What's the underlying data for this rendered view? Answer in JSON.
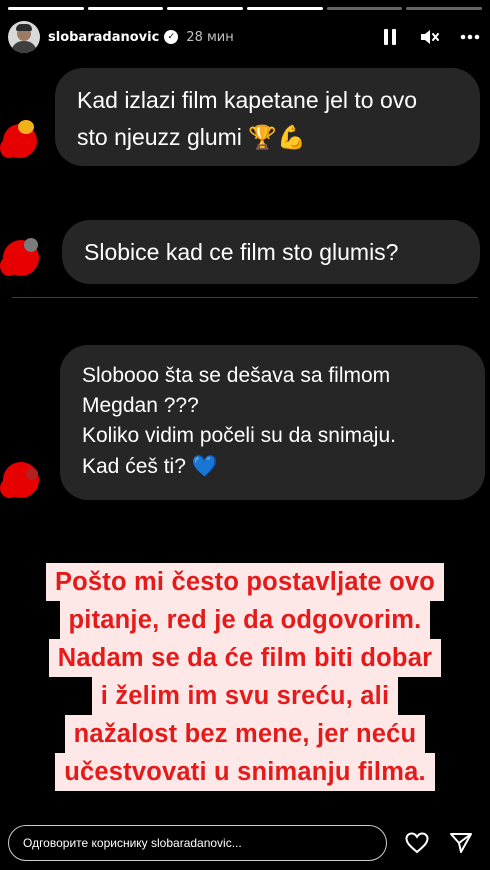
{
  "story": {
    "segments_total": 6,
    "segments_done": 4,
    "username": "slobaradanovic",
    "time": "28 мин"
  },
  "icons": {
    "verified": "verified-badge-icon",
    "pause": "pause-icon",
    "mute": "mute-icon",
    "more": "more-icon",
    "heart": "heart-icon",
    "share": "send-icon"
  },
  "messages": [
    {
      "lines": [
        "Kad izlazi film kapetane jel to ovo",
        "sto njeuzz glumi"
      ],
      "emoji": "🏆💪"
    },
    {
      "lines": [
        "Slobice kad ce film sto glumis?"
      ]
    },
    {
      "lines": [
        "Slobooo šta se dešava sa filmom",
        "Megdan ???",
        "Koliko vidim počeli su da snimaju.",
        "Kad ćeš ti?"
      ],
      "emoji": "💙"
    }
  ],
  "answer_lines": [
    "Pošto mi često postavljate ovo",
    "pitanje, red je da odgovorim.",
    "Nadam se da će film biti dobar",
    "i želim im svu sreću, ali",
    "nažalost bez mene, jer neću",
    "učestvovati u snimanju filma."
  ],
  "colors": {
    "answer_text": "#e51b1b",
    "answer_bg": "#fde7e7",
    "bubble_bg": "#262626",
    "censor": "#e60000"
  },
  "footer": {
    "reply_placeholder": "Одговорите кориснику slobaradanovic..."
  }
}
